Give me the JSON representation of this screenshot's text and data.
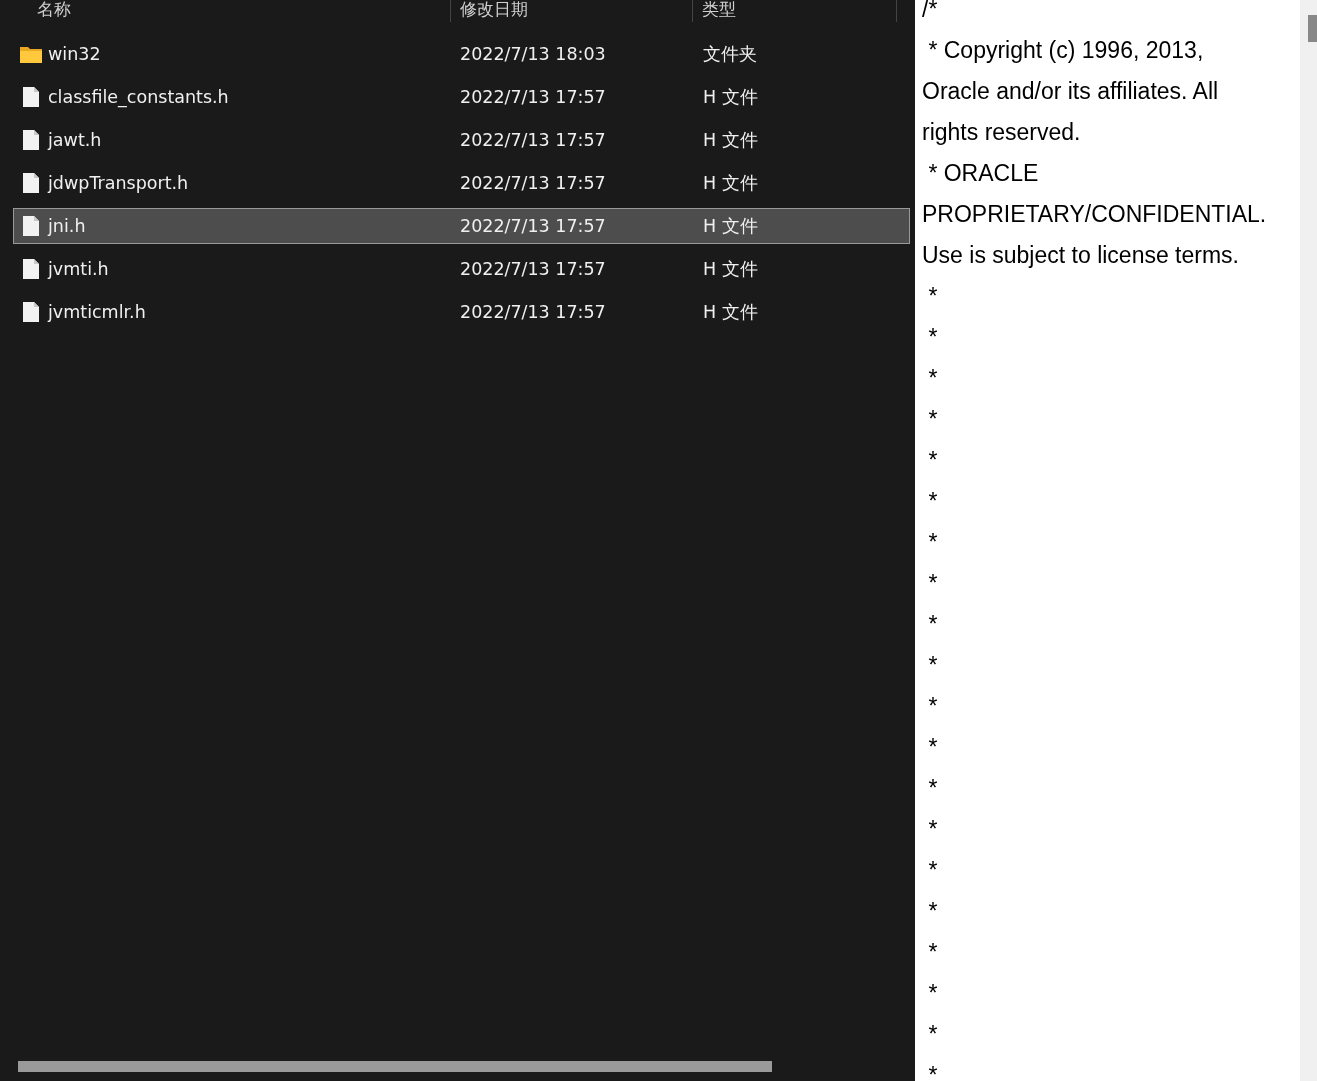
{
  "file_list": {
    "columns": [
      "名称",
      "修改日期",
      "类型"
    ],
    "rows": [
      {
        "kind": "folder",
        "name": "win32",
        "modified": "2022/7/13 18:03",
        "type": "文件夹",
        "selected": false
      },
      {
        "kind": "file",
        "name": "classfile_constants.h",
        "modified": "2022/7/13 17:57",
        "type": "H 文件",
        "selected": false
      },
      {
        "kind": "file",
        "name": "jawt.h",
        "modified": "2022/7/13 17:57",
        "type": "H 文件",
        "selected": false
      },
      {
        "kind": "file",
        "name": "jdwpTransport.h",
        "modified": "2022/7/13 17:57",
        "type": "H 文件",
        "selected": false
      },
      {
        "kind": "file",
        "name": "jni.h",
        "modified": "2022/7/13 17:57",
        "type": "H 文件",
        "selected": true
      },
      {
        "kind": "file",
        "name": "jvmti.h",
        "modified": "2022/7/13 17:57",
        "type": "H 文件",
        "selected": false
      },
      {
        "kind": "file",
        "name": "jvmticmlr.h",
        "modified": "2022/7/13 17:57",
        "type": "H 文件",
        "selected": false
      }
    ]
  },
  "preview": {
    "lines": [
      "/*",
      " * Copyright (c) 1996, 2013,",
      "Oracle and/or its affiliates. All",
      "rights reserved.",
      " * ORACLE",
      "PROPRIETARY/CONFIDENTIAL.",
      "Use is subject to license terms.",
      " *",
      " *",
      " *",
      " *",
      " *",
      " *",
      " *",
      " *",
      " *",
      " *",
      " *",
      " *",
      " *",
      " *",
      " *",
      " *",
      " *",
      " *",
      " *",
      " *"
    ]
  }
}
